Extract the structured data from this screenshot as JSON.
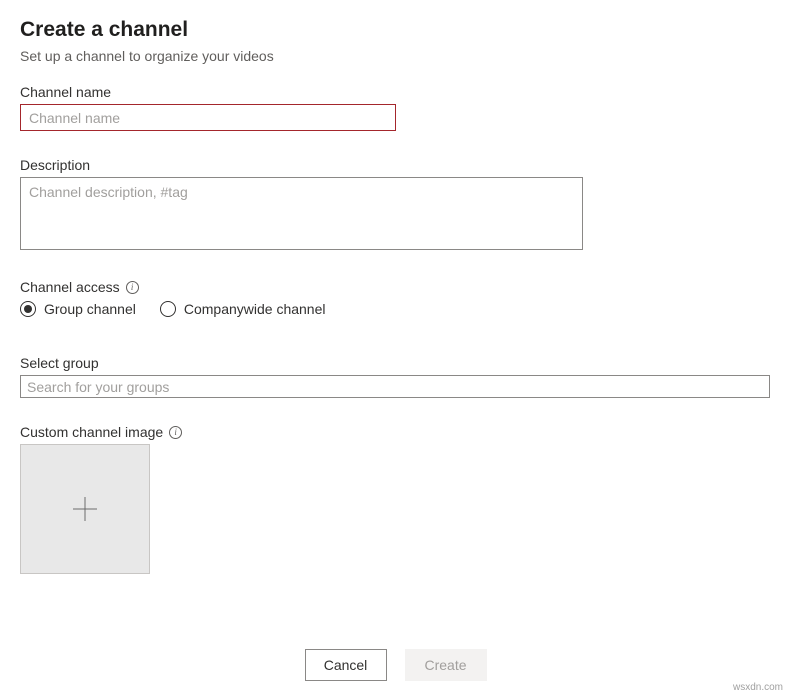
{
  "header": {
    "title": "Create a channel",
    "subtitle": "Set up a channel to organize your videos"
  },
  "form": {
    "name": {
      "label": "Channel name",
      "placeholder": "Channel name",
      "value": ""
    },
    "description": {
      "label": "Description",
      "placeholder": "Channel description, #tag",
      "value": ""
    },
    "access": {
      "label": "Channel access",
      "options": {
        "group": "Group channel",
        "company": "Companywide channel"
      },
      "selected": "group"
    },
    "selectGroup": {
      "label": "Select group",
      "placeholder": "Search for your groups",
      "value": ""
    },
    "customImage": {
      "label": "Custom channel image"
    }
  },
  "footer": {
    "cancel": "Cancel",
    "create": "Create"
  },
  "watermark": "wsxdn.com"
}
